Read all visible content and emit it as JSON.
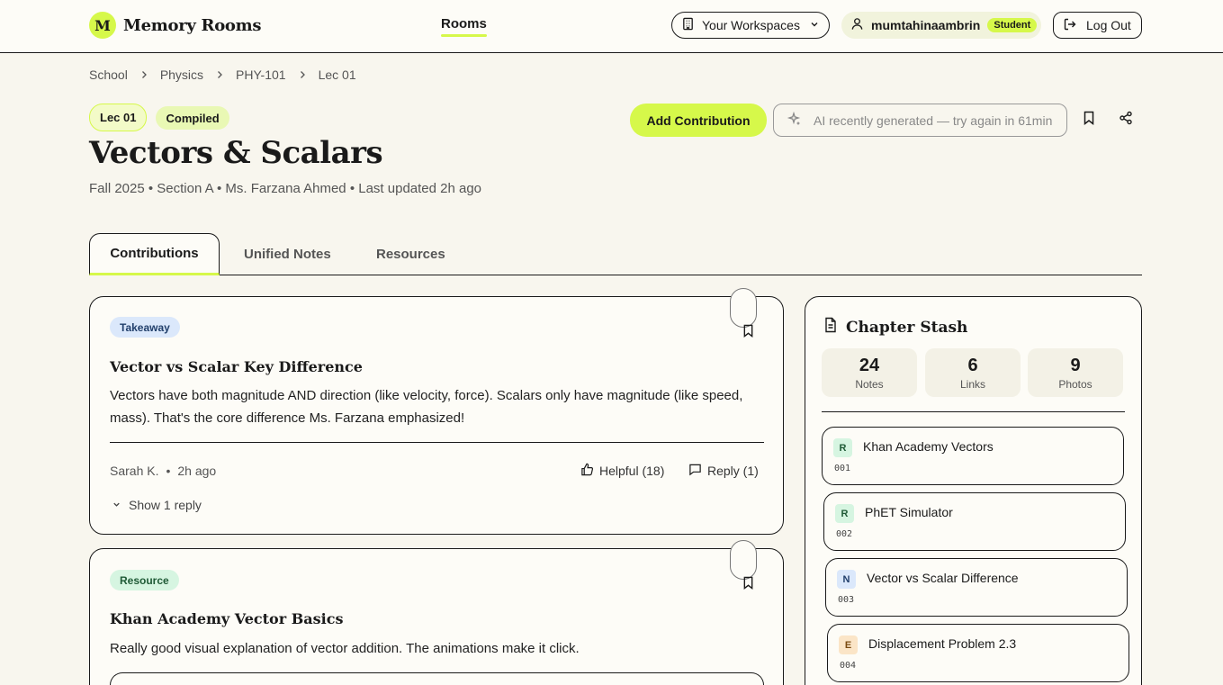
{
  "header": {
    "logo_letter": "M",
    "app_name": "Memory Rooms",
    "nav_rooms": "Rooms",
    "workspaces": "Your Workspaces",
    "username": "mumtahinaambrin",
    "role": "Student",
    "logout": "Log Out"
  },
  "breadcrumb": [
    "School",
    "Physics",
    "PHY-101",
    "Lec 01"
  ],
  "room": {
    "chip_lecture": "Lec 01",
    "chip_status": "Compiled",
    "title": "Vectors & Scalars",
    "meta": "Fall 2025 • Section A • Ms. Farzana Ahmed • Last updated 2h ago",
    "add_contribution": "Add Contribution",
    "ai_status": "AI recently generated — try again in 61min"
  },
  "tabs": [
    "Contributions",
    "Unified Notes",
    "Resources"
  ],
  "contributions": [
    {
      "tag": "Takeaway",
      "title": "Vector vs Scalar Key Difference",
      "body": "Vectors have both magnitude AND direction (like velocity, force). Scalars only have magnitude (like speed, mass). That's the core difference Ms. Farzana emphasized!",
      "author": "Sarah K.",
      "time": "2h ago",
      "helpful": "Helpful (18)",
      "reply": "Reply (1)",
      "show_replies": "Show 1 reply"
    },
    {
      "tag": "Resource",
      "title": "Khan Academy Vector Basics",
      "body": "Really good visual explanation of vector addition. The animations make it click."
    }
  ],
  "stash": {
    "title": "Chapter Stash",
    "stats": [
      {
        "value": "24",
        "label": "Notes"
      },
      {
        "value": "6",
        "label": "Links"
      },
      {
        "value": "9",
        "label": "Photos"
      }
    ],
    "items": [
      {
        "letter": "R",
        "name": "Khan Academy Vectors",
        "num": "001"
      },
      {
        "letter": "R",
        "name": "PhET Simulator",
        "num": "002"
      },
      {
        "letter": "N",
        "name": "Vector vs Scalar Difference",
        "num": "003"
      },
      {
        "letter": "E",
        "name": "Displacement Problem 2.3",
        "num": "004"
      }
    ]
  },
  "colors": {
    "accent": "#d6f84a",
    "background": "#f8f6ee",
    "ink": "#1a1a1a"
  }
}
